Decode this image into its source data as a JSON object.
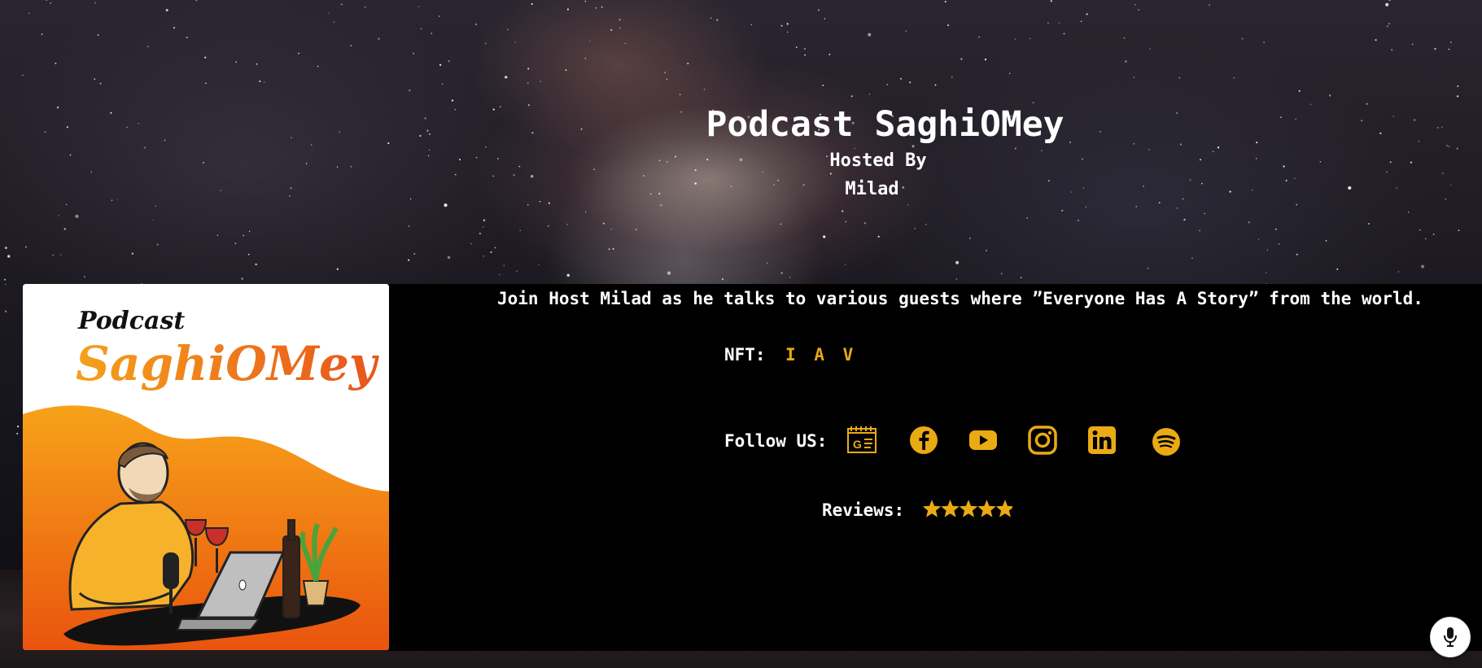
{
  "hero": {
    "title": "Podcast SaghiOMey",
    "hosted_by": "Hosted By",
    "host": "Milad"
  },
  "cover": {
    "logo_line1": "Podcast",
    "logo_line2": "SaghiOMey"
  },
  "description": "Join Host Milad as he talks to various guests where ”Everyone Has A Story” from the world.",
  "nft": {
    "label": "NFT:",
    "links": [
      "I",
      "A",
      "V"
    ]
  },
  "follow": {
    "label": "Follow US:",
    "icons": [
      "google-podcasts-icon",
      "facebook-icon",
      "youtube-icon",
      "instagram-icon",
      "linkedin-icon",
      "spotify-icon"
    ]
  },
  "reviews": {
    "label": "Reviews:",
    "rating": 5,
    "max": 5
  },
  "colors": {
    "accent": "#eaaa14",
    "panel": "#000000",
    "cover_orange": "#ef7a10"
  }
}
